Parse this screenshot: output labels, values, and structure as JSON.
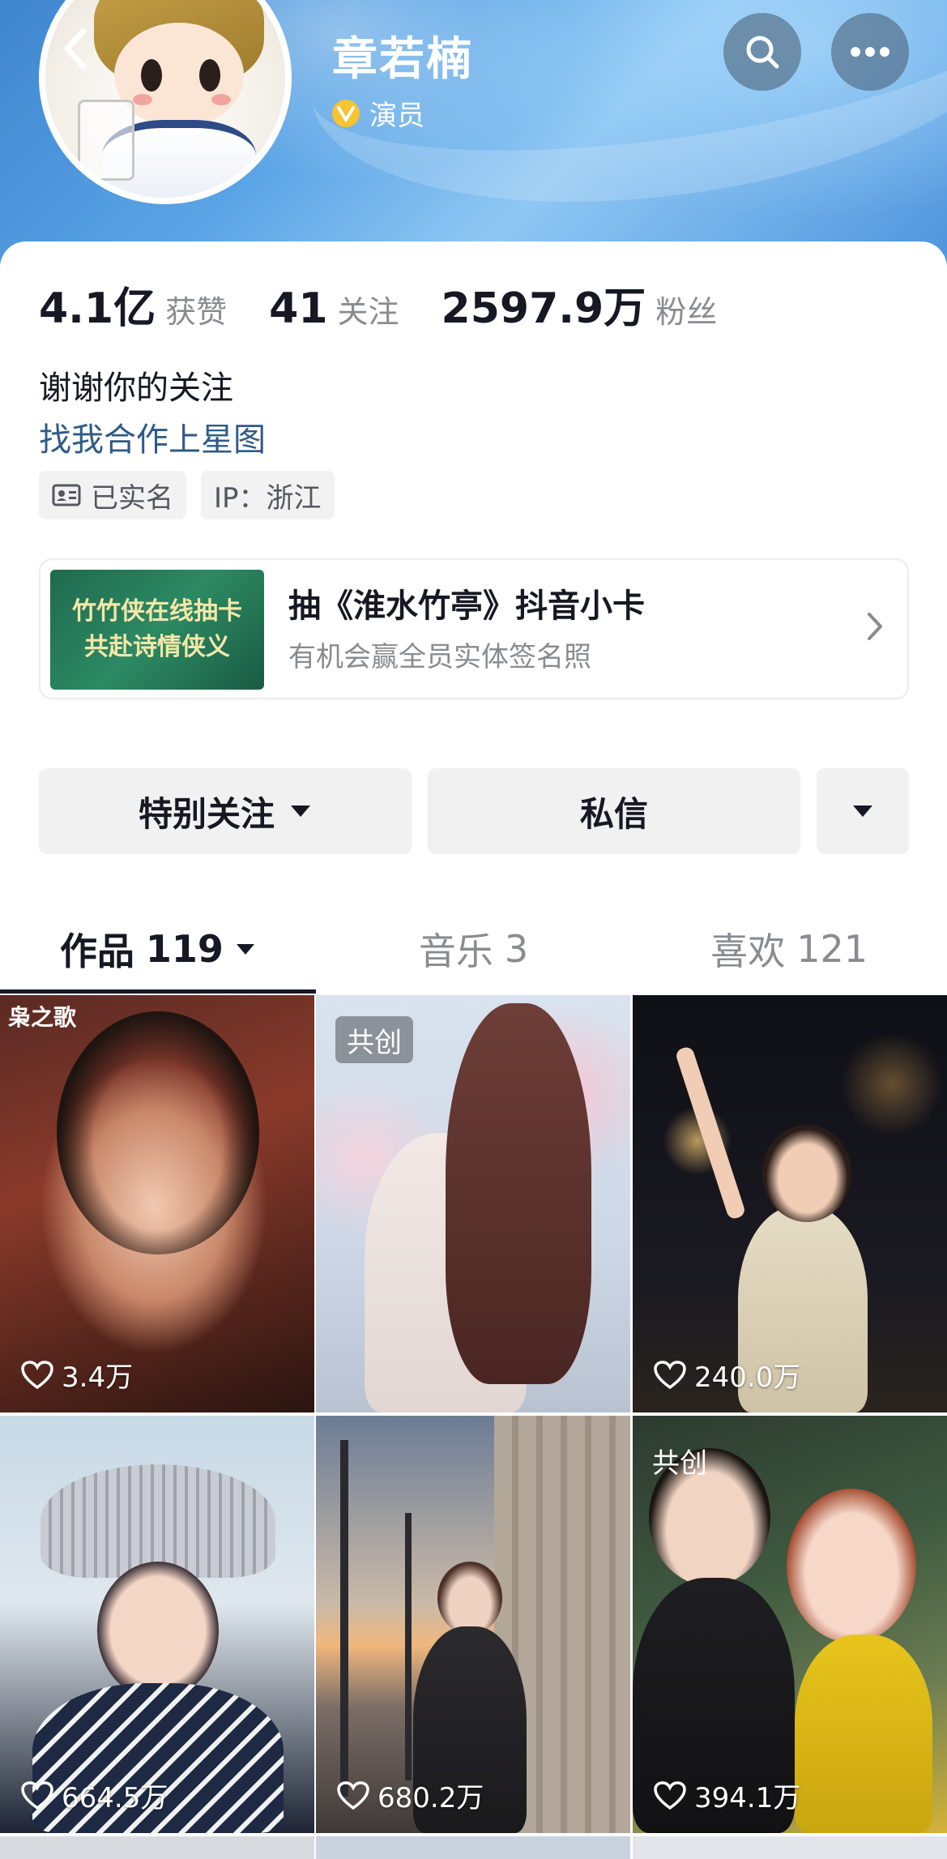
{
  "profile": {
    "name": "章若楠",
    "verification": "演员"
  },
  "stats": [
    {
      "value": "4.1亿",
      "label": "获赞"
    },
    {
      "value": "41",
      "label": "关注"
    },
    {
      "value": "2597.9万",
      "label": "粉丝"
    }
  ],
  "bio": {
    "text": "谢谢你的关注",
    "link": "找我合作上星图"
  },
  "tags": {
    "real_name": "已实名",
    "ip": "IP：浙江"
  },
  "promo": {
    "thumb_line1": "竹竹侠在线抽卡",
    "thumb_line2": "共赴诗情侠义",
    "title": "抽《淮水竹亭》抖音小卡",
    "subtitle": "有机会赢全员实体签名照"
  },
  "actions": {
    "follow": "特别关注",
    "message": "私信"
  },
  "tabs": [
    {
      "label": "作品",
      "count": "119"
    },
    {
      "label": "音乐",
      "count": "3"
    },
    {
      "label": "喜欢",
      "count": "121"
    }
  ],
  "videos": [
    {
      "likes": "3.4万",
      "badge": "",
      "watermark": "枭之歌"
    },
    {
      "likes": "",
      "badge": "共创",
      "watermark": ""
    },
    {
      "likes": "240.0万",
      "badge": "",
      "watermark": ""
    },
    {
      "likes": "664.5万",
      "badge": "",
      "watermark": ""
    },
    {
      "likes": "680.2万",
      "badge": "",
      "watermark": ""
    },
    {
      "likes": "394.1万",
      "badge": "共创",
      "watermark": ""
    }
  ],
  "colors": {
    "link": "#2f5a86",
    "verify_badge": "#f7c32f",
    "muted_text": "#8a8b91",
    "button_bg": "#f1f1f2"
  }
}
